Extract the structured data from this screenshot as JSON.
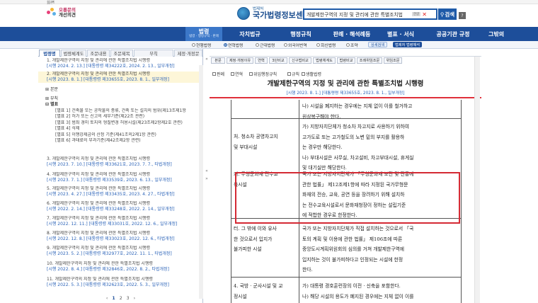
{
  "top": {
    "label": "화면"
  },
  "header": {
    "promo_line1": "오롱문의",
    "promo_line2": "개선의견",
    "logo_small": "법제처",
    "logo_title": "국가법령정보센터",
    "search_value": "개발제한구역의 지정 및 관리에 관한 특별조치법",
    "search_kbd": "한글",
    "clear_icon": "✕",
    "search_button": "검색",
    "help_button": "?"
  },
  "nav": {
    "active_label": "법령",
    "active_sub": "법령 · 행정규칙 · 판례",
    "items": [
      "자치법규",
      "행정규칙",
      "판례 · 해석례등",
      "별표 · 서식",
      "공공기관 규정",
      "그밖의"
    ]
  },
  "subnav": {
    "options": [
      "현행법령",
      "연혁법령",
      "근대법령",
      "외국어번역",
      "회신법령",
      "조약"
    ],
    "pill_a": "상세검색",
    "pill_b": "법제처 법령해석"
  },
  "left": {
    "tabs": [
      "법령명",
      "법령체계도",
      "조문내용",
      "조문제목",
      "부칙",
      "제정·개정문"
    ],
    "items": [
      {
        "title": "1. 개발제한구역의 지정 및 관리에 관한 특별조치법 시행령",
        "meta": "[시행 2024. 2. 13.] [대통령령 제34222호, 2024. 2. 13., 일부개정]"
      },
      {
        "title": "2. 개발제한구역의 지정 및 관리에 관한 특별조치법 시행령",
        "meta": "[시행 2023. 8. 1.] [대통령령 제33655호, 2023. 8. 1., 일부개정]"
      }
    ],
    "tree": {
      "bonmun": "본문",
      "buchik": "부칙",
      "byeolpyo": "별표",
      "leaves": [
        "[별표 1] 건축물 또는 공작물의 종류, 건축 또는 설치의 범위(제13조제1항",
        "[별표 2] 허가 또는 신고의 세부기준(제22조 관련)",
        "[별표 3] 범죄 경미 토지의 형질변경 허용시설(제23조제2항제2호 관련)",
        "[별표 4] 삭제",
        "[별표 5] 이행강제금의 산정 기준(제41조의2제1항 관련)",
        "[별표 6] 과태료의 부과기준(제42조제2항 관련)"
      ]
    },
    "items2": [
      {
        "title": "3. 개발제한구역의 지정 및 관리에 관한 특별조치법 시행령",
        "meta": "[시행 2023. 7. 10.] [대통령령 제33621호, 2023. 7. 7., 타법개정]"
      },
      {
        "title": "4. 개발제한구역의 지정 및 관리에 관한 특별조치법 시행령",
        "meta": "[시행 2023. 7. 1.] [대통령령 제33539호, 2023. 6. 13., 일부개정]"
      },
      {
        "title": "5. 개발제한구역의 지정 및 관리에 관한 특별조치법 시행령",
        "meta": "[시행 2023. 4. 27.] [대통령령 제33435호, 2023. 4. 27., 타법개정]"
      },
      {
        "title": "6. 개발제한구역의 지정 및 관리에 관한 특별조치법 시행령",
        "meta": "[시행 2022. 2. 14.] [대통령령 제33248호, 2022. 2. 14., 일부개정]"
      },
      {
        "title": "7. 개발제한구역의 지정 및 관리에 관한 특별조치법 시행령",
        "meta": "[시행 2022. 12. 11.] [대통령령 제33031호, 2022. 12. 6., 일부개정]"
      },
      {
        "title": "8. 개발제한구역의 지정 및 관리에 관한 특별조치법 시행령",
        "meta": "[시행 2022. 12. 8.] [대통령령 제33023호, 2022. 12. 6., 타법개정]"
      },
      {
        "title": "9. 개발제한구역의 지정 및 관리에 관한 특별조치법 시행령",
        "meta": "[시행 2023. 5. 2.] [대통령령 제32977호, 2022. 11. 1., 타법개정]"
      },
      {
        "title": "10. 개발제한구역의 지정 및 관리에 관한 특별조치법 시행령",
        "meta": "[시행 2022. 8. 4.] [대통령령 제32846호, 2022. 8. 2., 타법개정]"
      },
      {
        "title": "11. 개발제한구역의 지정 및 관리에 관한 특별조치법 시행령",
        "meta": "[시행 2022. 5. 3.] [대통령령 제32623호, 2022. 5. 3., 일부개정]"
      }
    ],
    "pager": [
      "‹",
      "1",
      "2",
      "3",
      "›"
    ]
  },
  "right": {
    "buttons": [
      "본문",
      "제정·개정이유",
      "연혁",
      "3단비교",
      "신구법비교",
      "법령체계도",
      "법령비교",
      "조례위임조문",
      "위임조문"
    ],
    "tools": [
      "판례",
      "연혁",
      "위임행정규칙",
      "규칙",
      "생활법령"
    ],
    "doc_title": "개발제한구역의 지정 및 관리에 관한 특별조치법 시행령",
    "doc_sub": "[시행 2023. 8. 1.] [대통령령 제33655호, 2023. 8. 1., 일부개정]",
    "rows": [
      {
        "label": [],
        "content": [
          "나) 시설을 폐지하는 경우에는 지체 없이 이를 철거하고",
          "원상복구해야 한다."
        ]
      },
      {
        "label": [
          "처. 청소차 공영차고지",
          "및 부대시설"
        ],
        "content": [
          "가) 지방자치단체가 청소차 차고지로 사용하기 위하여",
          "고가도로 또는 고가철도의 노변 밑의 부지를 활용하",
          "는 경우만 해당한다.",
          "나) 부대시설은 사무실, 차고설비, 차고부대시설, 휴게실",
          "및 대기실만 해당한다."
        ]
      },
      {
        "label": [
          "커. 무형문화재 전수교",
          "육시설"
        ],
        "content": [
          "국가 또는 지방자치단체가 「무형문화재 보전 및 진흥에",
          "관한 법률」 제12조제1항에 따라 지정된 국가무형문",
          "화재의 전승, 교육, 공연 등을 장려하기 위해 설치하",
          "는 전수교육시설로서 문화재청장이 정하는 설립기준",
          "에 적합한 경우로 한정한다."
        ]
      },
      {
        "label": [
          "터. 그 밖에 이와 유사",
          "한 것으로서 입지가",
          "불가피한 시설"
        ],
        "content": [
          "국가 또는 지방자치단체가 직접 설치하는 것으로서 「국",
          "토의 계획 및 이용에 관한 법률」 제106조에 따른",
          "중앙도시계획위원회의 심의를 거쳐 개발제한구역에",
          "입지하는 것이 불가피하다고 인정되는 시설에 한정",
          "한다."
        ]
      },
      {
        "label": [
          "4. 국방 · 군사시설 및 교",
          "정시설"
        ],
        "content": [
          "가) 대통령 경호훈련장의 이전 · 신축을 포함한다.",
          "나) 해당 시설의 용도가 폐지된 경우에는 지체 없이 이를"
        ]
      }
    ]
  }
}
